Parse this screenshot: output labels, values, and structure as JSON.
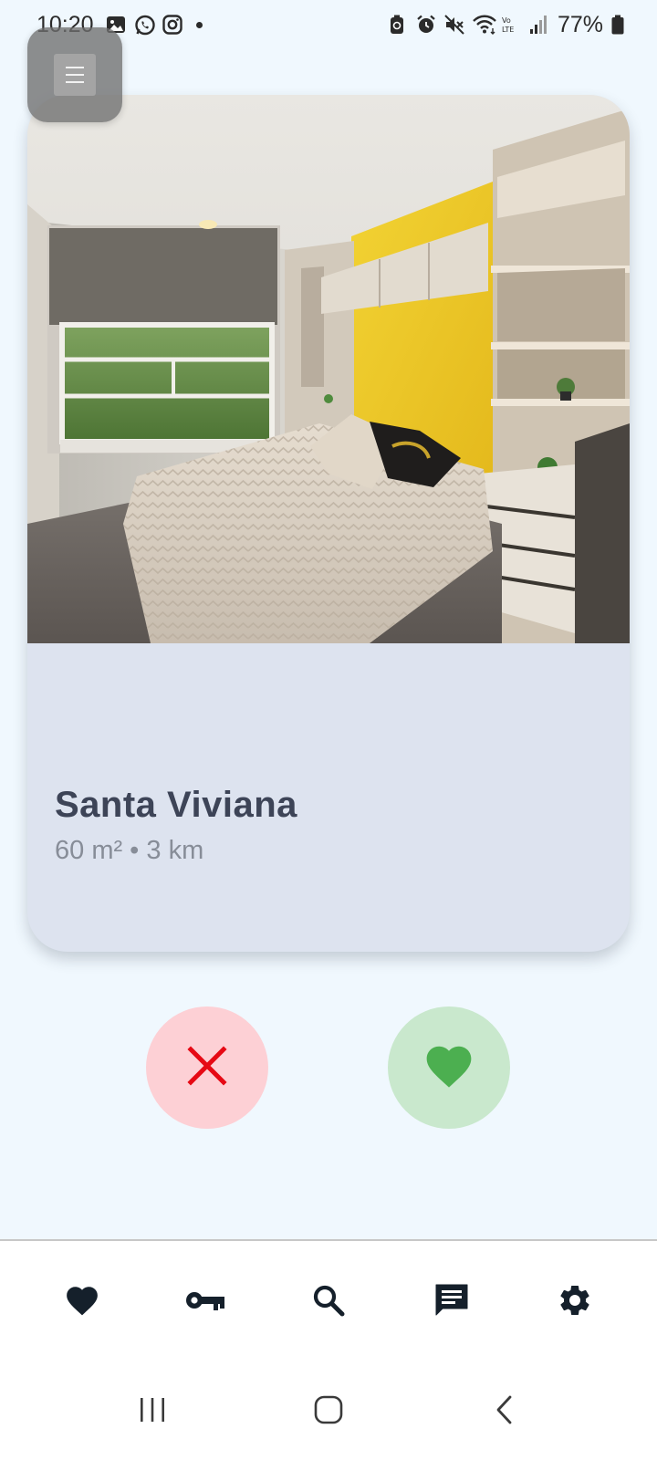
{
  "status_bar": {
    "time": "10:20",
    "battery": "77%",
    "left_icons": [
      "gallery-icon",
      "whatsapp-icon",
      "instagram-icon",
      "notification-dot"
    ],
    "right_icons": [
      "battery-saver-icon",
      "alarm-icon",
      "mute-icon",
      "wifi-icon",
      "volte-icon",
      "signal-icon",
      "battery-icon"
    ]
  },
  "menu": {
    "icon": "hamburger-menu-icon"
  },
  "listing": {
    "title": "Santa Viviana",
    "subtitle": "60 m² • 3 km",
    "photo": "bedroom-photo"
  },
  "actions": {
    "reject_icon": "close-icon",
    "like_icon": "heart-icon",
    "reject_color": "#e60914",
    "like_color": "#4caf50"
  },
  "bottom_nav": {
    "items": [
      {
        "icon": "heart-icon"
      },
      {
        "icon": "key-icon"
      },
      {
        "icon": "search-icon"
      },
      {
        "icon": "chat-icon"
      },
      {
        "icon": "gear-icon"
      }
    ]
  },
  "system_nav": {
    "items": [
      {
        "icon": "recents-icon"
      },
      {
        "icon": "home-icon"
      },
      {
        "icon": "back-icon"
      }
    ]
  },
  "colors": {
    "background": "#f0f8fe",
    "card": "#dde3ef",
    "title": "#3d4457",
    "subtitle": "#878d98"
  }
}
